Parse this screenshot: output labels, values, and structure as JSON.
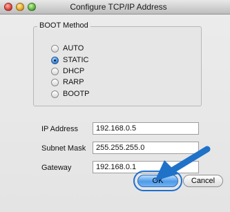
{
  "window": {
    "title": "Configure TCP/IP Address"
  },
  "boot_method": {
    "title": "BOOT Method",
    "options": [
      {
        "label": "AUTO",
        "selected": false
      },
      {
        "label": "STATIC",
        "selected": true
      },
      {
        "label": "DHCP",
        "selected": false
      },
      {
        "label": "RARP",
        "selected": false
      },
      {
        "label": "BOOTP",
        "selected": false
      }
    ]
  },
  "fields": {
    "ip_address": {
      "label": "IP Address",
      "value": "192.168.0.5"
    },
    "subnet_mask": {
      "label": "Subnet Mask",
      "value": "255.255.255.0"
    },
    "gateway": {
      "label": "Gateway",
      "value": "192.168.0.1"
    }
  },
  "buttons": {
    "ok": "OK",
    "cancel": "Cancel"
  },
  "colors": {
    "pointer_arrow": "#1f72c8",
    "accent": "#3f86d8"
  },
  "icons": {
    "pointer": "arrow-pointer-icon"
  }
}
